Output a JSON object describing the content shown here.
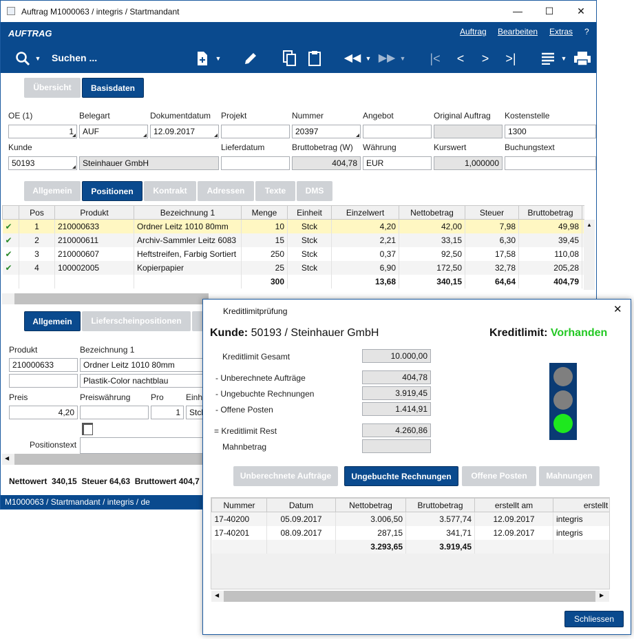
{
  "window": {
    "title": "Auftrag M1000063 / integris / Startmandant",
    "minimize": "—",
    "maximize": "☐",
    "close": "✕"
  },
  "appbar": {
    "brand": "AUFTRAG",
    "menu": [
      "Auftrag",
      "Bearbeiten",
      "Extras",
      "?"
    ]
  },
  "toolbar": {
    "search_label": "Suchen ..."
  },
  "tabs_top": [
    "Übersicht",
    "Basisdaten"
  ],
  "form": {
    "oe_label": "OE (1)",
    "oe_value": "1",
    "belegart_label": "Belegart",
    "belegart_value": "AUF",
    "dokumentdatum_label": "Dokumentdatum",
    "dokumentdatum_value": "12.09.2017",
    "projekt_label": "Projekt",
    "projekt_value": "",
    "nummer_label": "Nummer",
    "nummer_value": "20397",
    "angebot_label": "Angebot",
    "angebot_value": "",
    "original_label": "Original Auftrag",
    "original_value": "",
    "kostenstelle_label": "Kostenstelle",
    "kostenstelle_value": "1300",
    "kunde_label": "Kunde",
    "kunde_value": "50193",
    "kunde_name": "Steinhauer GmbH",
    "lieferdatum_label": "Lieferdatum",
    "lieferdatum_value": "",
    "brutto_label": "Bruttobetrag (W)",
    "brutto_value": "404,78",
    "waehrung_label": "Währung",
    "waehrung_value": "EUR",
    "kurs_label": "Kurswert",
    "kurs_value": "1,000000",
    "buchung_label": "Buchungstext",
    "buchung_value": ""
  },
  "tabs_mid": [
    "Allgemein",
    "Positionen",
    "Kontrakt",
    "Adressen",
    "Texte",
    "DMS"
  ],
  "positions": {
    "headers": [
      "Pos",
      "Produkt",
      "Bezeichnung 1",
      "Menge",
      "Einheit",
      "Einzelwert",
      "Nettobetrag",
      "Steuer",
      "Bruttobetrag"
    ],
    "rows": [
      [
        "✔",
        "1",
        "210000633",
        "Ordner Leitz 1010 80mm",
        "10",
        "Stck",
        "4,20",
        "42,00",
        "7,98",
        "49,98"
      ],
      [
        "✔",
        "2",
        "210000611",
        "Archiv-Sammler Leitz 6083",
        "15",
        "Stck",
        "2,21",
        "33,15",
        "6,30",
        "39,45"
      ],
      [
        "✔",
        "3",
        "210000607",
        "Heftstreifen, Farbig Sortiert",
        "250",
        "Stck",
        "0,37",
        "92,50",
        "17,58",
        "110,08"
      ],
      [
        "✔",
        "4",
        "100002005",
        "Kopierpapier",
        "25",
        "Stck",
        "6,90",
        "172,50",
        "32,78",
        "205,28"
      ]
    ],
    "totals": {
      "menge": "300",
      "einzelwert": "13,68",
      "netto": "340,15",
      "steuer": "64,64",
      "brutto": "404,79"
    }
  },
  "tabs_low": [
    "Allgemein",
    "Lieferscheinpositionen"
  ],
  "detail": {
    "produkt_label": "Produkt",
    "produkt_value": "210000633",
    "bez_label": "Bezeichnung 1",
    "bez_value": "Ordner Leitz 1010 80mm",
    "bez2_value": "Plastik-Color nachtblau",
    "preis_label": "Preis",
    "preis_value": "4,20",
    "pw_label": "Preiswährung",
    "pw_value": "",
    "pro_label": "Pro",
    "pro_value": "1",
    "einh_label": "Einh",
    "einh_value": "Stck",
    "postext_label": "Positionstext"
  },
  "summary": {
    "text": "Nettowert  340,15  Steuer 64,63  Bruttowert 404,7"
  },
  "status": {
    "text": "M1000063 / Startmandant / integris / de"
  },
  "dialog": {
    "title": "Kreditlimitprüfung",
    "kunde_label": "Kunde:",
    "kunde_value": "50193 / Steinhauer GmbH",
    "kl_label": "Kreditlimit:",
    "kl_value": "Vorhanden",
    "rows": [
      {
        "label": "Kreditlimit Gesamt",
        "value": "10.000,00"
      },
      {
        "label": "- Unberechnete Aufträge",
        "value": "404,78"
      },
      {
        "label": "- Ungebuchte Rechnungen",
        "value": "3.919,45"
      },
      {
        "label": "- Offene Posten",
        "value": "1.414,91"
      },
      {
        "label": "= Kreditlimit Rest",
        "value": "4.260,86"
      },
      {
        "label": "Mahnbetrag",
        "value": ""
      }
    ],
    "tabs": [
      "Unberechnete Aufträge",
      "Ungebuchte Rechnungen",
      "Offene Posten",
      "Mahnungen"
    ],
    "grid_headers": [
      "Nummer",
      "Datum",
      "Nettobetrag",
      "Bruttobetrag",
      "erstellt am",
      "erstellt"
    ],
    "grid_rows": [
      [
        "17-40200",
        "05.09.2017",
        "3.006,50",
        "3.577,74",
        "12.09.2017",
        "integris"
      ],
      [
        "17-40201",
        "08.09.2017",
        "287,15",
        "341,71",
        "12.09.2017",
        "integris"
      ]
    ],
    "grid_totals": {
      "netto": "3.293,65",
      "brutto": "3.919,45"
    },
    "close_button": "Schliessen",
    "light_colors": [
      "#7f7f7f",
      "#7f7f7f",
      "#1ee81e"
    ]
  }
}
